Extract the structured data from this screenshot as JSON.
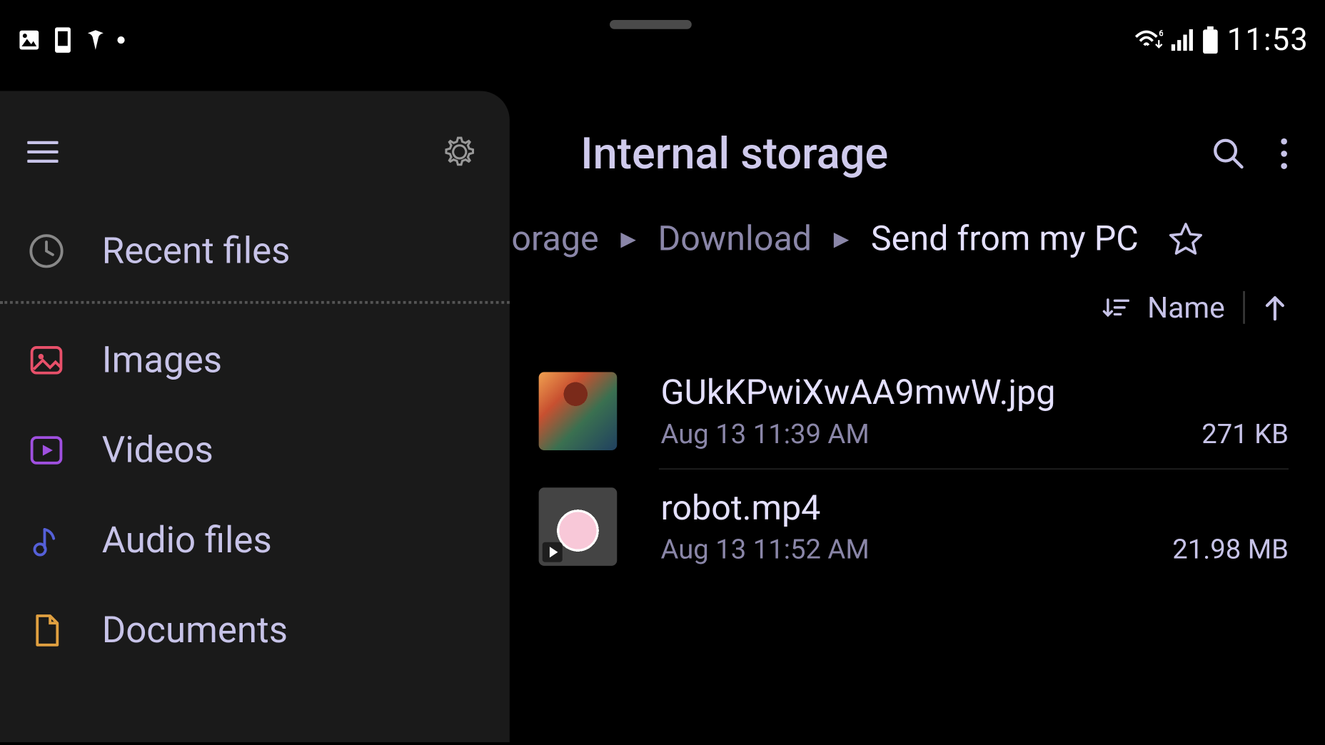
{
  "status": {
    "time": "11:53"
  },
  "sidebar": {
    "items": [
      {
        "label": "Recent files"
      },
      {
        "label": "Images"
      },
      {
        "label": "Videos"
      },
      {
        "label": "Audio files"
      },
      {
        "label": "Documents"
      }
    ]
  },
  "main": {
    "title": "Internal storage",
    "breadcrumb": [
      {
        "label": "orage"
      },
      {
        "label": "Download"
      },
      {
        "label": "Send from my PC"
      }
    ],
    "sort": {
      "label": "Name"
    },
    "files": [
      {
        "name": "GUkKPwiXwAA9mwW.jpg",
        "date": "Aug 13 11:39 AM",
        "size": "271 KB",
        "type": "image"
      },
      {
        "name": "robot.mp4",
        "date": "Aug 13 11:52 AM",
        "size": "21.98 MB",
        "type": "video"
      }
    ]
  }
}
